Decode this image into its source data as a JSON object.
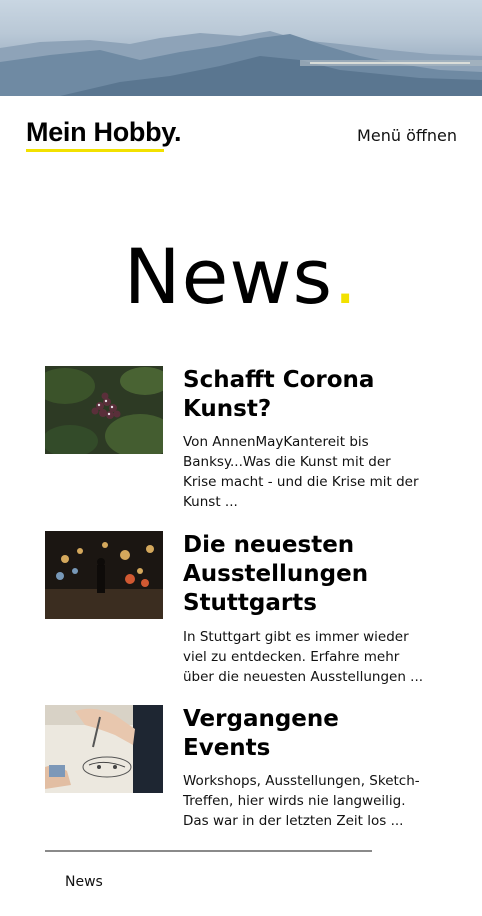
{
  "header": {
    "logo": "Mein Hobby.",
    "menu_label": "Menü öffnen"
  },
  "page": {
    "title": "News",
    "title_dot": "."
  },
  "articles": [
    {
      "title": "Schafft Corona Kunst?",
      "excerpt": "Von AnnenMayKantereit bis Banksy...Was die Kunst mit der Krise macht - und die Krise mit der Kunst ...",
      "image": "flower-buds-photo"
    },
    {
      "title": "Die neuesten Ausstellungen Stuttgarts",
      "excerpt": "In Stuttgart gibt es immer wieder viel zu entdecken. Erfahre mehr über die neuesten Ausstellungen ...",
      "image": "night-street-lights-photo"
    },
    {
      "title": "Vergangene Events",
      "excerpt": "Workshops, Ausstellungen, Sketch-Treffen, hier wirds nie langweilig. Das war in der letzten Zeit los ...",
      "image": "sketching-hands-photo"
    }
  ],
  "footer": {
    "nav_label": "News"
  },
  "colors": {
    "accent": "#f2e100",
    "text": "#000000",
    "divider": "#8a8a8a"
  }
}
